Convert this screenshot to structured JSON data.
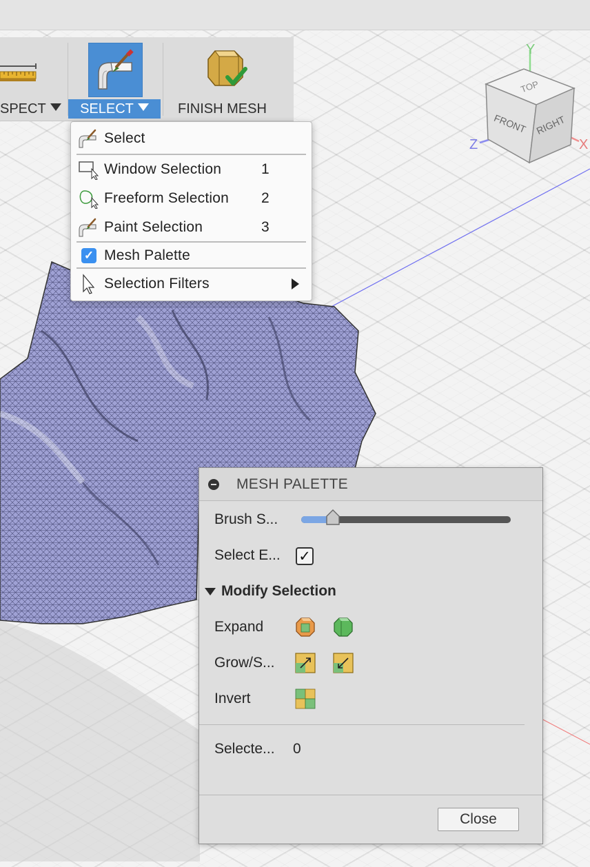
{
  "toolbar": {
    "inspect_label": "SPECT",
    "select_label": "SELECT",
    "finish_label": "FINISH MESH"
  },
  "select_menu": {
    "items": [
      {
        "label": "Select",
        "shortcut": ""
      },
      {
        "label": "Window Selection",
        "shortcut": "1"
      },
      {
        "label": "Freeform Selection",
        "shortcut": "2"
      },
      {
        "label": "Paint Selection",
        "shortcut": "3"
      },
      {
        "label": "Mesh Palette",
        "shortcut": "",
        "checked": true
      },
      {
        "label": "Selection Filters",
        "shortcut": "",
        "submenu": true
      }
    ]
  },
  "view_cube": {
    "top": "TOP",
    "front": "FRONT",
    "right": "RIGHT",
    "axis_y": "Y",
    "axis_z": "Z",
    "axis_x": "X"
  },
  "palette": {
    "title": "MESH PALETTE",
    "brush_label": "Brush S...",
    "brush_value": 0.15,
    "select_label": "Select E...",
    "select_checked": "✓",
    "section_title": "Modify Selection",
    "expand_label": "Expand",
    "grow_label": "Grow/S...",
    "invert_label": "Invert",
    "selected_label": "Selecte...",
    "selected_count": "0",
    "close_label": "Close"
  },
  "colors": {
    "accent": "#4a8ed4",
    "mesh": "#9b9ccf",
    "check_blue": "#3a90f0"
  }
}
